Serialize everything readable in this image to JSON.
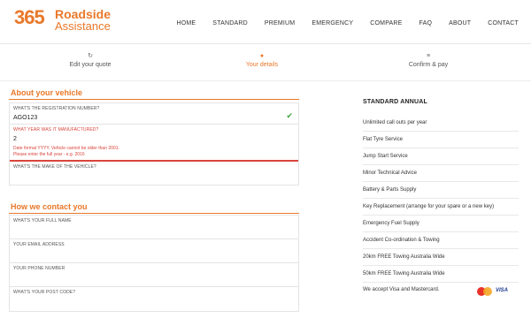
{
  "brand": {
    "number": "365",
    "line1": "Roadside",
    "line2": "Assistance",
    "color": "#e9782a"
  },
  "nav": [
    "HOME",
    "STANDARD",
    "PREMIUM",
    "EMERGENCY",
    "COMPARE",
    "FAQ",
    "ABOUT",
    "CONTACT"
  ],
  "steps": [
    {
      "icon": "refresh-icon",
      "glyph": "↻",
      "label": "Edit your quote",
      "active": false
    },
    {
      "icon": "user-icon",
      "glyph": "●",
      "label": "Your details",
      "active": true
    },
    {
      "icon": "list-icon",
      "glyph": "≡",
      "label": "Confirm & pay",
      "active": false
    }
  ],
  "vehicle": {
    "title": "About your vehicle",
    "registration_label": "WHAT'S THE REGISTRATION NUMBER?",
    "registration_value": "AGO123",
    "year_label": "WHAT YEAR WAS IT MANUFACTURED?",
    "year_value": "2",
    "year_error_1": "Date format YYYY. Vehicle cannot be older than 2001.",
    "year_error_2": "Please enter the full year - e.g. 2016",
    "make_label": "WHAT'S THE MAKE OF THE VEHICLE?"
  },
  "contact": {
    "title": "How we contact you",
    "name_label": "WHAT'S YOUR FULL NAME",
    "email_label": "YOUR EMAIL ADDRESS",
    "phone_label": "YOUR PHONE NUMBER",
    "postcode_label": "WHAT'S YOUR POST CODE?"
  },
  "plan": {
    "title": "STANDARD ANNUAL",
    "items": [
      "Unlimited call outs per year",
      "Flat Tyre Service",
      "Jump Start Service",
      "Minor Technical Advice",
      "Battery & Parts Supply",
      "Key Replacement (arrange for your spare or a new key)",
      "Emergency Fuel Supply",
      "Accident Co-ordination & Towing",
      "20km FREE Towing Australia Wide",
      "50km FREE Towing Australia Wide"
    ],
    "payment_text": "We accept Visa and Mastercard.",
    "visa_text": "VISA"
  },
  "colors": {
    "accent": "#e9782a",
    "error": "#d9453c",
    "success": "#3aa33a"
  }
}
